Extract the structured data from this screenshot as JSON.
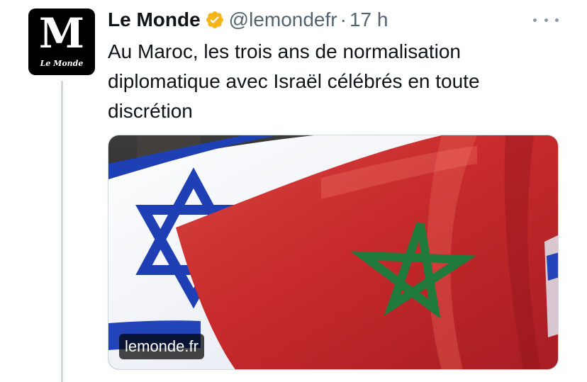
{
  "tweet": {
    "author": {
      "display_name": "Le Monde",
      "handle": "@lemondefr",
      "separator": "·",
      "time": "17 h",
      "avatar_letter": "M",
      "avatar_caption": "Le Monde",
      "verified_icon": "verified-gold-badge-icon"
    },
    "text": "Au Maroc, les trois ans de normalisation diplomatique avec Israël célébrés en toute discrétion",
    "media": {
      "source_label": "lemonde.fr",
      "description_icon": "israel-and-morocco-flags-photo"
    },
    "more_icon": "more-horizontal-icon"
  },
  "colors": {
    "accent_gold": "#f4b41a",
    "text_primary": "#0f1419",
    "text_secondary": "#536471",
    "morocco_red": "#c1272d",
    "morocco_green": "#006233",
    "israel_blue": "#0038b8"
  }
}
